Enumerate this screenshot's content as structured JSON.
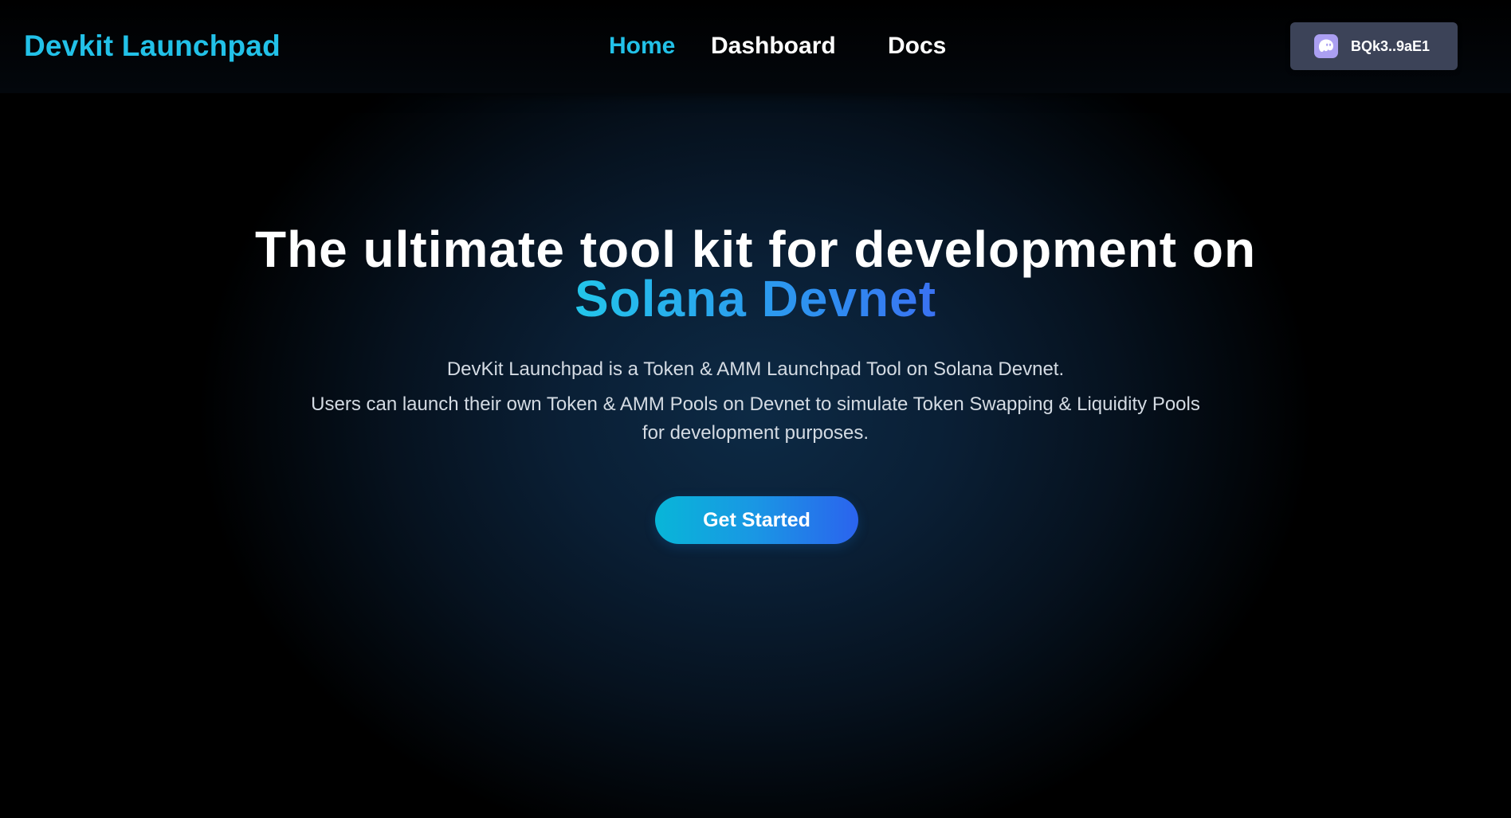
{
  "header": {
    "brand": "Devkit Launchpad",
    "nav": [
      {
        "label": "Home",
        "active": true
      },
      {
        "label": "Dashboard",
        "active": false
      },
      {
        "label": "Docs",
        "active": false
      }
    ],
    "wallet": {
      "icon": "phantom-ghost-icon",
      "address": "BQk3..9aE1"
    }
  },
  "hero": {
    "title_line1": "The ultimate tool kit for development on",
    "title_line2": "Solana Devnet",
    "description_1": "DevKit Launchpad is a Token & AMM Launchpad Tool on Solana Devnet.",
    "description_2": "Users can launch their own Token & AMM Pools on Devnet to simulate Token Swapping & Liquidity Pools for development purposes.",
    "cta_label": "Get Started"
  },
  "colors": {
    "accent": "#22c1e8",
    "wallet_bg": "#3c4358",
    "cta_start": "#08b6d8",
    "cta_end": "#2b63ee",
    "background": "#000000"
  }
}
